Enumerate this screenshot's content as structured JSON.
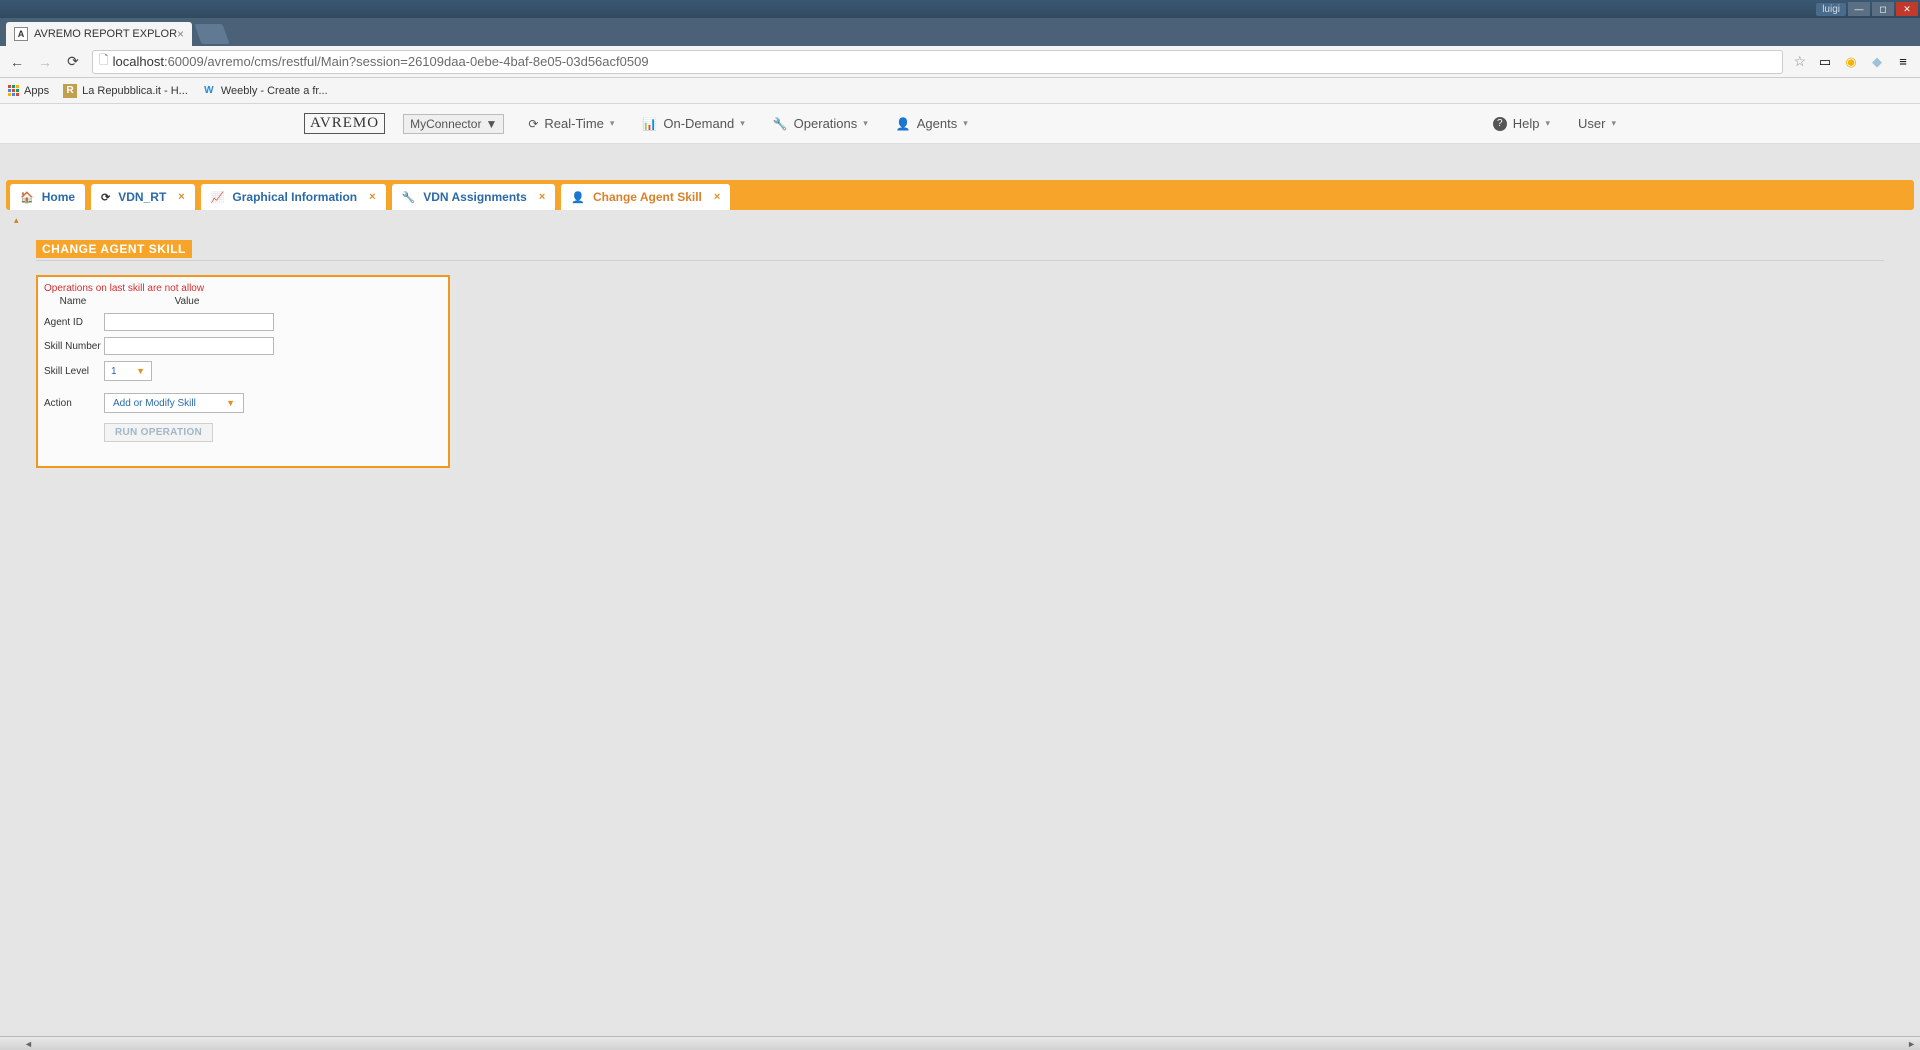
{
  "browser": {
    "tab_title": "AVREMO REPORT EXPLOR",
    "user_badge": "luigi",
    "url_host": "localhost",
    "url_port_path": ":60009/avremo/cms/restful/Main?session=26109daa-0ebe-4baf-8e05-03d56acf0509"
  },
  "bookmarks": {
    "apps": "Apps",
    "rep": "La Repubblica.it - H...",
    "weebly": "Weebly - Create a fr..."
  },
  "menubar": {
    "logo": "AVREMO",
    "connector": "MyConnector",
    "items": {
      "realtime": "Real-Time",
      "ondemand": "On-Demand",
      "operations": "Operations",
      "agents": "Agents",
      "help": "Help",
      "user": "User"
    }
  },
  "tabs": {
    "home": "Home",
    "vdn_rt": "VDN_RT",
    "graphical": "Graphical Information",
    "vdn_assign": "VDN Assignments",
    "change_agent": "Change Agent Skill"
  },
  "panel": {
    "title": "CHANGE AGENT SKILL",
    "warning": "Operations on last skill are not allow",
    "col_name": "Name",
    "col_value": "Value",
    "fields": {
      "agent_id": "Agent ID",
      "skill_number": "Skill Number",
      "skill_level": "Skill Level",
      "action": "Action"
    },
    "values": {
      "agent_id": "",
      "skill_number": "",
      "skill_level": "1",
      "action": "Add or Modify Skill"
    },
    "run_button": "RUN OPERATION"
  }
}
